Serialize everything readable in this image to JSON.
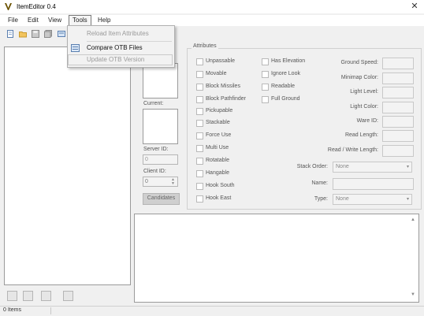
{
  "window": {
    "title": "ItemEditor 0.4",
    "close_glyph": "✕"
  },
  "menu": {
    "items": [
      "File",
      "Edit",
      "View",
      "Tools",
      "Help"
    ],
    "tools_dropdown": {
      "items": [
        {
          "label": "Reload Item Attributes",
          "enabled": false
        },
        {
          "label": "Compare OTB Files",
          "enabled": true
        },
        {
          "label": "Update OTB Version",
          "enabled": false
        }
      ]
    }
  },
  "toolbar": {
    "icons": [
      "new-icon",
      "open-icon",
      "save-icon",
      "save-as-icon",
      "settings-icon"
    ]
  },
  "left_panel": {
    "current_label": "Current:",
    "server_id_label": "Server ID:",
    "server_id_value": "0",
    "client_id_label": "Client ID:",
    "client_id_value": "0",
    "candidates_label": "Candidates"
  },
  "attributes": {
    "title": "Attributes",
    "checkboxes_col1": [
      "Unpassable",
      "Movable",
      "Block Missiles",
      "Block Pathfinder",
      "Pickupable",
      "Stackable",
      "Force Use",
      "Multi Use",
      "Rotatable",
      "Hangable",
      "Hook South",
      "Hook East"
    ],
    "checkboxes_col2": [
      "Has Elevation",
      "Ignore Look",
      "Readable",
      "Full Ground"
    ],
    "properties": [
      "Ground Speed:",
      "Minimap Color:",
      "Light Level:",
      "Light Color:",
      "Ware ID:",
      "Read Length:",
      "Read / Write Length:"
    ],
    "stack_order_label": "Stack Order:",
    "stack_order_value": "None",
    "name_label": "Name:",
    "type_label": "Type:",
    "type_value": "None"
  },
  "log": {
    "scroll_up": "▲",
    "scroll_down": "▼"
  },
  "bottom_toolbar": {
    "icons": [
      "add-item-icon",
      "duplicate-item-icon",
      "reload-item-icon",
      "find-item-icon"
    ]
  },
  "status": {
    "items_text": "0 Items"
  },
  "colors": {
    "window_bg": "#f0f0f0",
    "panel_bg": "#ffffff",
    "border": "#9a9a9a"
  }
}
